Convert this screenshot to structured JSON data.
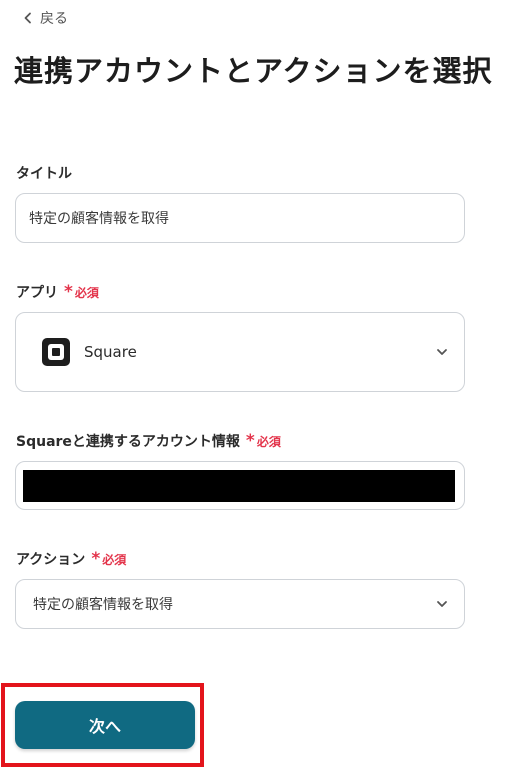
{
  "header": {
    "back_label": "戻る",
    "title": "連携アカウントとアクションを選択"
  },
  "form": {
    "title_field": {
      "label": "タイトル",
      "value": "特定の顧客情報を取得"
    },
    "app_field": {
      "label": "アプリ",
      "required_mark": "*",
      "required_label": "必須",
      "value": "Square"
    },
    "account_field": {
      "label": "Squareと連携するアカウント情報",
      "required_mark": "*",
      "required_label": "必須"
    },
    "action_field": {
      "label": "アクション",
      "required_mark": "*",
      "required_label": "必須",
      "value": "特定の顧客情報を取得"
    }
  },
  "next_button": {
    "label": "次へ"
  },
  "colors": {
    "accent": "#106a82",
    "required": "#e3344b",
    "highlight": "#e3141b"
  }
}
